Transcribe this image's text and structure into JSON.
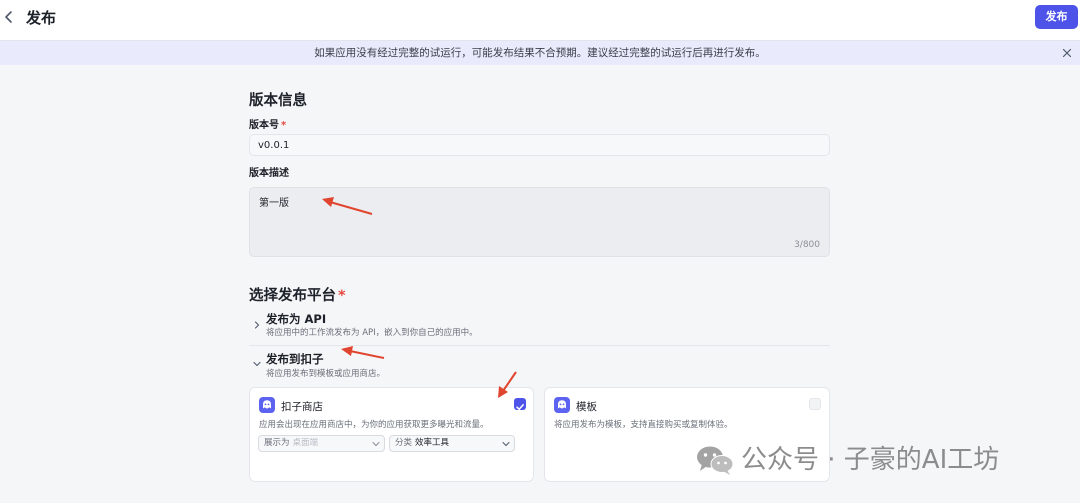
{
  "header": {
    "title": "发布",
    "publish_label": "发布"
  },
  "notice": {
    "text": "如果应用没有经过完整的试运行，可能发布结果不合预期。建议经过完整的试运行后再进行发布。"
  },
  "version_info": {
    "section_title": "版本信息",
    "version_label": "版本号",
    "required_mark": "*",
    "version_value": "v0.0.1",
    "description_label": "版本描述",
    "description_value": "第一版",
    "char_count": "3/800"
  },
  "platform": {
    "section_title": "选择发布平台",
    "required_mark": "*",
    "options": [
      {
        "title": "发布为 API",
        "subtitle": "将应用中的工作流发布为 API，嵌入到你自己的应用中。",
        "expanded": false
      },
      {
        "title": "发布到扣子",
        "subtitle": "将应用发布到模板或应用商店。",
        "expanded": true
      }
    ],
    "cards": [
      {
        "title": "扣子商店",
        "description": "应用会出现在应用商店中，为你的应用获取更多曝光和流量。",
        "checked": true,
        "display_key": "展示为",
        "display_value": "桌面端",
        "category_key": "分类",
        "category_value": "效率工具"
      },
      {
        "title": "模板",
        "description": "将应用发布为模板，支持直接购买或复制体验。",
        "checked": false
      }
    ]
  },
  "watermark": {
    "text": "公众号 · 子豪的AI工坊"
  },
  "colors": {
    "accent": "#4d53e8",
    "notice_bg": "#e9ebfc",
    "required": "#e5483f",
    "annotation_arrow": "#e0452f"
  },
  "icons": {
    "back": "chevron-left-icon",
    "close": "close-icon",
    "card_app": "bot-app-icon",
    "wechat": "wechat-logo-icon"
  }
}
